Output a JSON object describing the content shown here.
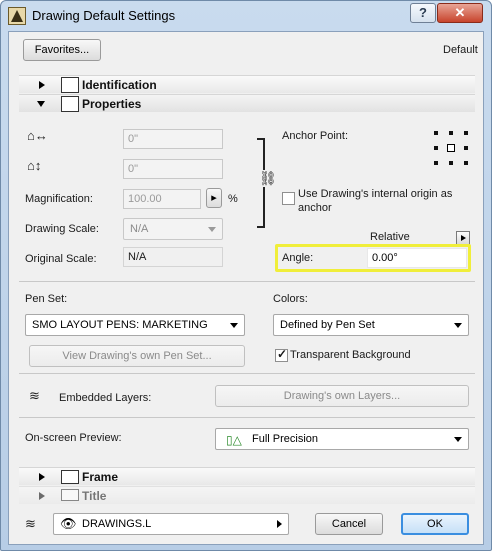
{
  "window": {
    "title": "Drawing Default Settings",
    "help_label": "?",
    "close_label": "✕"
  },
  "top": {
    "favorites_label": "Favorites...",
    "default_label": "Default"
  },
  "sections": {
    "identification": "Identification",
    "properties": "Properties",
    "frame": "Frame",
    "title": "Title"
  },
  "properties": {
    "width_value": "0\"",
    "height_value": "0\"",
    "magnification_label": "Magnification:",
    "magnification_value": "100.00",
    "percent": "%",
    "drawing_scale_label": "Drawing Scale:",
    "drawing_scale_value": "N/A",
    "original_scale_label": "Original Scale:",
    "original_scale_value": "N/A",
    "anchor_point_label": "Anchor Point:",
    "use_origin_label_1": "Use Drawing's internal origin as",
    "use_origin_label_2": "anchor",
    "relative_label": "Relative",
    "angle_label": "Angle:",
    "angle_value": "0.00°"
  },
  "pens": {
    "pen_set_label": "Pen Set:",
    "pen_set_value": "SMO LAYOUT PENS: MARKETING",
    "view_pen_set_label": "View Drawing's own Pen Set...",
    "colors_label": "Colors:",
    "colors_value": "Defined by Pen Set",
    "transparent_bg_label": "Transparent Background",
    "transparent_bg_checked": true
  },
  "layers": {
    "embedded_layers_label": "Embedded Layers:",
    "own_layers_label": "Drawing's own Layers..."
  },
  "preview": {
    "label": "On-screen Preview:",
    "value": "Full Precision"
  },
  "footer": {
    "layer_value": "DRAWINGS.L",
    "cancel_label": "Cancel",
    "ok_label": "OK"
  },
  "colors": {
    "highlight": "#f0ee3a",
    "accent": "#3a8ee0"
  }
}
